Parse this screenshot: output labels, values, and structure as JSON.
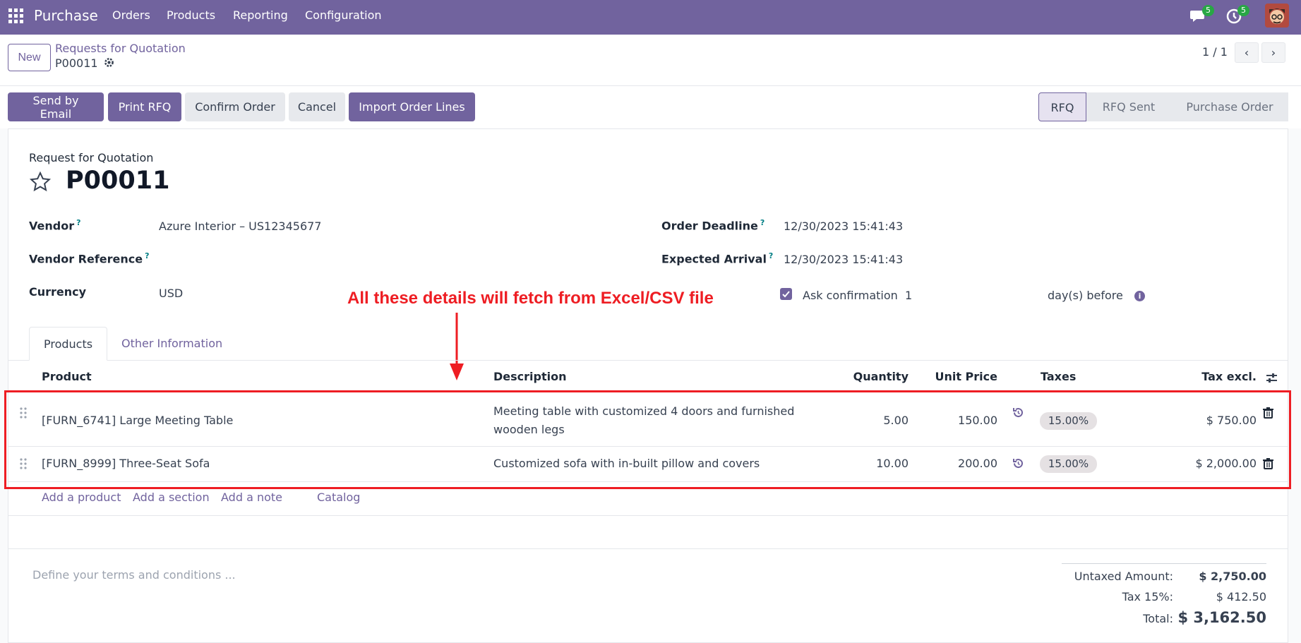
{
  "navbar": {
    "app_name": "Purchase",
    "menu": [
      "Orders",
      "Products",
      "Reporting",
      "Configuration"
    ],
    "messages_badge": "5",
    "activities_badge": "5"
  },
  "control_panel": {
    "new_label": "New",
    "breadcrumb_parent": "Requests for Quotation",
    "breadcrumb_current": "P00011",
    "pager": "1 / 1"
  },
  "actions": {
    "send_email": "Send by Email",
    "print_rfq": "Print RFQ",
    "confirm_order": "Confirm Order",
    "cancel": "Cancel",
    "import_lines": "Import Order Lines"
  },
  "statusbar": {
    "stages": [
      "RFQ",
      "RFQ Sent",
      "Purchase Order"
    ],
    "active": "RFQ"
  },
  "form": {
    "subtitle": "Request for Quotation",
    "title": "P00011",
    "vendor_label": "Vendor",
    "vendor_value": "Azure Interior – US12345677",
    "vendor_ref_label": "Vendor Reference",
    "vendor_ref_value": "",
    "currency_label": "Currency",
    "currency_value": "USD",
    "order_deadline_label": "Order Deadline",
    "order_deadline_value": "12/30/2023 15:41:43",
    "expected_arrival_label": "Expected Arrival",
    "expected_arrival_value": "12/30/2023 15:41:43",
    "ask_confirmation_label": "Ask confirmation",
    "ask_confirmation_days": "1",
    "days_before_label": "day(s) before",
    "help_mark": "?"
  },
  "annotation": {
    "text": "All these details will fetch from Excel/CSV file",
    "color": "#ee1d23"
  },
  "tabs": [
    "Products",
    "Other Information"
  ],
  "table": {
    "headers": {
      "product": "Product",
      "description": "Description",
      "quantity": "Quantity",
      "unit_price": "Unit Price",
      "taxes": "Taxes",
      "tax_excl": "Tax excl."
    },
    "rows": [
      {
        "product": "[FURN_6741] Large Meeting Table",
        "description_1": "Meeting table with customized 4 doors and furnished",
        "description_2": "wooden legs",
        "quantity": "5.00",
        "unit_price": "150.00",
        "tax": "15.00%",
        "subtotal": "$ 750.00"
      },
      {
        "product": "[FURN_8999] Three-Seat Sofa",
        "description_1": "Customized sofa with in-built pillow and covers",
        "description_2": "",
        "quantity": "10.00",
        "unit_price": "200.00",
        "tax": "15.00%",
        "subtotal": "$ 2,000.00"
      }
    ],
    "add_links": [
      "Add a product",
      "Add a section",
      "Add a note",
      "Catalog"
    ]
  },
  "footer": {
    "terms_placeholder": "Define your terms and conditions ...",
    "untaxed_label": "Untaxed Amount:",
    "untaxed_value": "$ 2,750.00",
    "tax_label": "Tax 15%:",
    "tax_value": "$ 412.50",
    "total_label": "Total:",
    "total_value": "$ 3,162.50"
  },
  "colors": {
    "brand": "#71639e",
    "badge": "#28a745",
    "annotation": "#ee1d23"
  },
  "icons": [
    "apps-grid-icon",
    "chat-icon",
    "clock-icon",
    "gear-icon",
    "star-icon",
    "chevron-left-icon",
    "chevron-right-icon",
    "drag-handle-icon",
    "history-icon",
    "trash-icon",
    "optional-columns-icon",
    "info-icon",
    "checkmark-icon",
    "arrow-down-icon"
  ]
}
